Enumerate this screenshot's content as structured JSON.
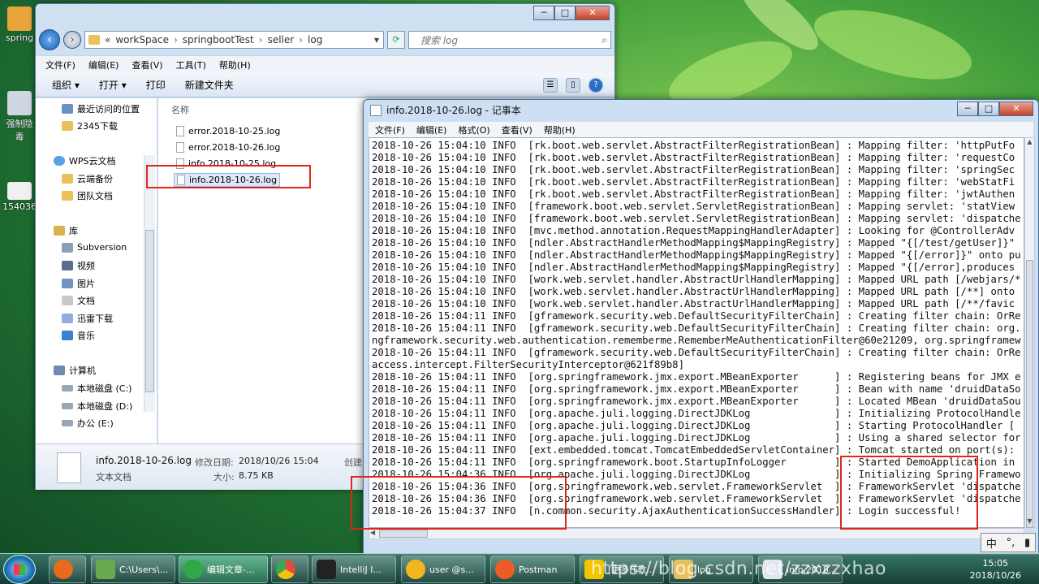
{
  "desktop": {
    "icons": [
      {
        "label": "spring"
      },
      {
        "label": "强制隐\n毒"
      },
      {
        "label": "154036"
      }
    ]
  },
  "explorer": {
    "window_controls": {
      "minimize": "─",
      "maximize": "□",
      "close": "✕"
    },
    "breadcrumb": [
      "«",
      "workSpace",
      "springbootTest",
      "seller",
      "log"
    ],
    "search_placeholder": "搜索 log",
    "menu": [
      "文件(F)",
      "编辑(E)",
      "查看(V)",
      "工具(T)",
      "帮助(H)"
    ],
    "toolbar": {
      "organize": "组织",
      "open": "打开",
      "print": "打印",
      "new_folder": "新建文件夹"
    },
    "nav_items": [
      {
        "label": "最近访问的位置",
        "color": "#6a8fc2"
      },
      {
        "label": "2345下载",
        "color": "#e8c15b"
      },
      {
        "label": "WPS云文档",
        "color": "#5aa0e6"
      },
      {
        "label": "云端备份",
        "color": "#e8c15b"
      },
      {
        "label": "团队文档",
        "color": "#e8c15b"
      },
      {
        "label": "库",
        "color": "#d9b24e"
      },
      {
        "label": "Subversion",
        "color": "#8aa0b8"
      },
      {
        "label": "视频",
        "color": "#5b6f8a"
      },
      {
        "label": "图片",
        "color": "#6f94bf"
      },
      {
        "label": "文档",
        "color": "#c9c9c9"
      },
      {
        "label": "迅雷下载",
        "color": "#8fb0d6"
      },
      {
        "label": "音乐",
        "color": "#3a7fd0"
      },
      {
        "label": "计算机",
        "color": "#6b8bb0"
      },
      {
        "label": "本地磁盘 (C:)",
        "color": "#9aa6b4"
      },
      {
        "label": "本地磁盘 (D:)",
        "color": "#9aa6b4"
      },
      {
        "label": "办公 (E:)",
        "color": "#9aa6b4"
      }
    ],
    "column_header": "名称",
    "files": [
      "error.2018-10-25.log",
      "error.2018-10-26.log",
      "info.2018-10-25.log",
      "info.2018-10-26.log"
    ],
    "details": {
      "name": "info.2018-10-26.log",
      "type": "文本文档",
      "modified_label": "修改日期:",
      "modified_value": "2018/10/26 15:04",
      "size_label": "大小:",
      "size_value": "8.75 KB",
      "created_label": "创建"
    }
  },
  "notepad": {
    "title": "info.2018-10-26.log - 记事本",
    "window_controls": {
      "minimize": "─",
      "maximize": "□",
      "close": "✕"
    },
    "menu": [
      "文件(F)",
      "编辑(E)",
      "格式(O)",
      "查看(V)",
      "帮助(H)"
    ],
    "lines": [
      "2018-10-26 15:04:10 INFO  [rk.boot.web.servlet.AbstractFilterRegistrationBean] : Mapping filter: 'httpPutFo",
      "2018-10-26 15:04:10 INFO  [rk.boot.web.servlet.AbstractFilterRegistrationBean] : Mapping filter: 'requestCo",
      "2018-10-26 15:04:10 INFO  [rk.boot.web.servlet.AbstractFilterRegistrationBean] : Mapping filter: 'springSec",
      "2018-10-26 15:04:10 INFO  [rk.boot.web.servlet.AbstractFilterRegistrationBean] : Mapping filter: 'webStatFi",
      "2018-10-26 15:04:10 INFO  [rk.boot.web.servlet.AbstractFilterRegistrationBean] : Mapping filter: 'jwtAuthen",
      "2018-10-26 15:04:10 INFO  [framework.boot.web.servlet.ServletRegistrationBean] : Mapping servlet: 'statView",
      "2018-10-26 15:04:10 INFO  [framework.boot.web.servlet.ServletRegistrationBean] : Mapping servlet: 'dispatche",
      "2018-10-26 15:04:10 INFO  [mvc.method.annotation.RequestMappingHandlerAdapter] : Looking for @ControllerAdv",
      "2018-10-26 15:04:10 INFO  [ndler.AbstractHandlerMethodMapping$MappingRegistry] : Mapped \"{[/test/getUser]}\"",
      "2018-10-26 15:04:10 INFO  [ndler.AbstractHandlerMethodMapping$MappingRegistry] : Mapped \"{[/error]}\" onto pu",
      "2018-10-26 15:04:10 INFO  [ndler.AbstractHandlerMethodMapping$MappingRegistry] : Mapped \"{[/error],produces",
      "2018-10-26 15:04:10 INFO  [work.web.servlet.handler.AbstractUrlHandlerMapping] : Mapped URL path [/webjars/*",
      "2018-10-26 15:04:10 INFO  [work.web.servlet.handler.AbstractUrlHandlerMapping] : Mapped URL path [/**] onto",
      "2018-10-26 15:04:10 INFO  [work.web.servlet.handler.AbstractUrlHandlerMapping] : Mapped URL path [/**/favic",
      "2018-10-26 15:04:11 INFO  [gframework.security.web.DefaultSecurityFilterChain] : Creating filter chain: OrRe",
      "2018-10-26 15:04:11 INFO  [gframework.security.web.DefaultSecurityFilterChain] : Creating filter chain: org.",
      "ngframework.security.web.authentication.rememberme.RememberMeAuthenticationFilter@60e21209, org.springframew",
      "2018-10-26 15:04:11 INFO  [gframework.security.web.DefaultSecurityFilterChain] : Creating filter chain: OrRe",
      "access.intercept.FilterSecurityInterceptor@621f89b8]",
      "2018-10-26 15:04:11 INFO  [org.springframework.jmx.export.MBeanExporter      ] : Registering beans for JMX e",
      "2018-10-26 15:04:11 INFO  [org.springframework.jmx.export.MBeanExporter      ] : Bean with name 'druidDataSo",
      "2018-10-26 15:04:11 INFO  [org.springframework.jmx.export.MBeanExporter      ] : Located MBean 'druidDataSou",
      "2018-10-26 15:04:11 INFO  [org.apache.juli.logging.DirectJDKLog              ] : Initializing ProtocolHandle",
      "2018-10-26 15:04:11 INFO  [org.apache.juli.logging.DirectJDKLog              ] : Starting ProtocolHandler [",
      "2018-10-26 15:04:11 INFO  [org.apache.juli.logging.DirectJDKLog              ] : Using a shared selector for",
      "2018-10-26 15:04:11 INFO  [ext.embedded.tomcat.TomcatEmbeddedServletContainer] : Tomcat started on port(s):",
      "2018-10-26 15:04:11 INFO  [org.springframework.boot.StartupInfoLogger        ] : Started DemoApplication in",
      "2018-10-26 15:04:36 INFO  [org.apache.juli.logging.DirectJDKLog              ] : Initializing Spring Framewo",
      "2018-10-26 15:04:36 INFO  [org.springframework.web.servlet.FrameworkServlet  ] : FrameworkServlet 'dispatche",
      "2018-10-26 15:04:36 INFO  [org.springframework.web.servlet.FrameworkServlet  ] : FrameworkServlet 'dispatche",
      "2018-10-26 15:04:37 INFO  [n.common.security.AjaxAuthenticationSuccessHandler] : Login successful!"
    ]
  },
  "taskbar": {
    "items": [
      {
        "label": "",
        "color": "#e86a1a"
      },
      {
        "label": "C:\\Users\\...",
        "color": "#6aa84f"
      },
      {
        "label": "编辑文章-...",
        "color": "#2ea84a"
      },
      {
        "label": "",
        "color": "#e34b3b"
      },
      {
        "label": "IntelliJ I...",
        "color": "#222"
      },
      {
        "label": "user @s...",
        "color": "#f3b61f"
      },
      {
        "label": "Postman",
        "color": "#ef5b25"
      },
      {
        "label": "[更多IT教...",
        "color": "#f5c400"
      },
      {
        "label": "log",
        "color": "#e8c15b"
      },
      {
        "label": "info.2018...",
        "color": "#dfe7f0"
      }
    ],
    "watermark": "https://blog.csdn.net/zzxzzxhao",
    "time": "15:05",
    "date": "2018/10/26",
    "ime": [
      "中",
      "°,",
      "▮"
    ]
  },
  "colors": {
    "highlight_box": "#e2241b"
  }
}
